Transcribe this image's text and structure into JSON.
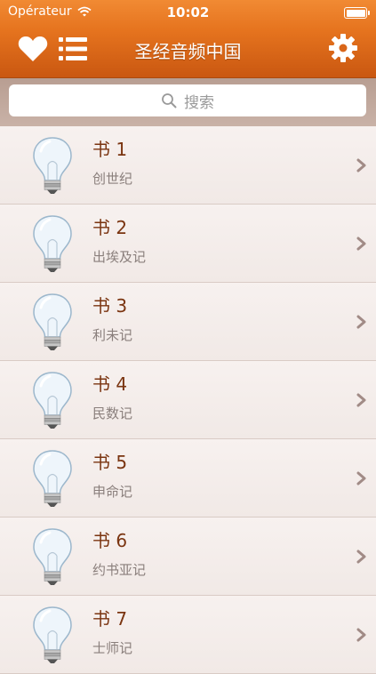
{
  "status_bar": {
    "carrier": "Opérateur",
    "time": "10:02"
  },
  "nav": {
    "title": "圣经音频中国"
  },
  "search": {
    "placeholder": "搜索"
  },
  "books": [
    {
      "title": "书 1",
      "name": "创世纪"
    },
    {
      "title": "书 2",
      "name": "出埃及记"
    },
    {
      "title": "书 3",
      "name": "利未记"
    },
    {
      "title": "书 4",
      "name": "民数记"
    },
    {
      "title": "书 5",
      "name": "申命记"
    },
    {
      "title": "书 6",
      "name": "约书亚记"
    },
    {
      "title": "书 7",
      "name": "士师记"
    }
  ],
  "colors": {
    "nav_orange": "#e5731e",
    "title_brown": "#7a3410",
    "subtitle_gray": "#8a7f7c"
  }
}
